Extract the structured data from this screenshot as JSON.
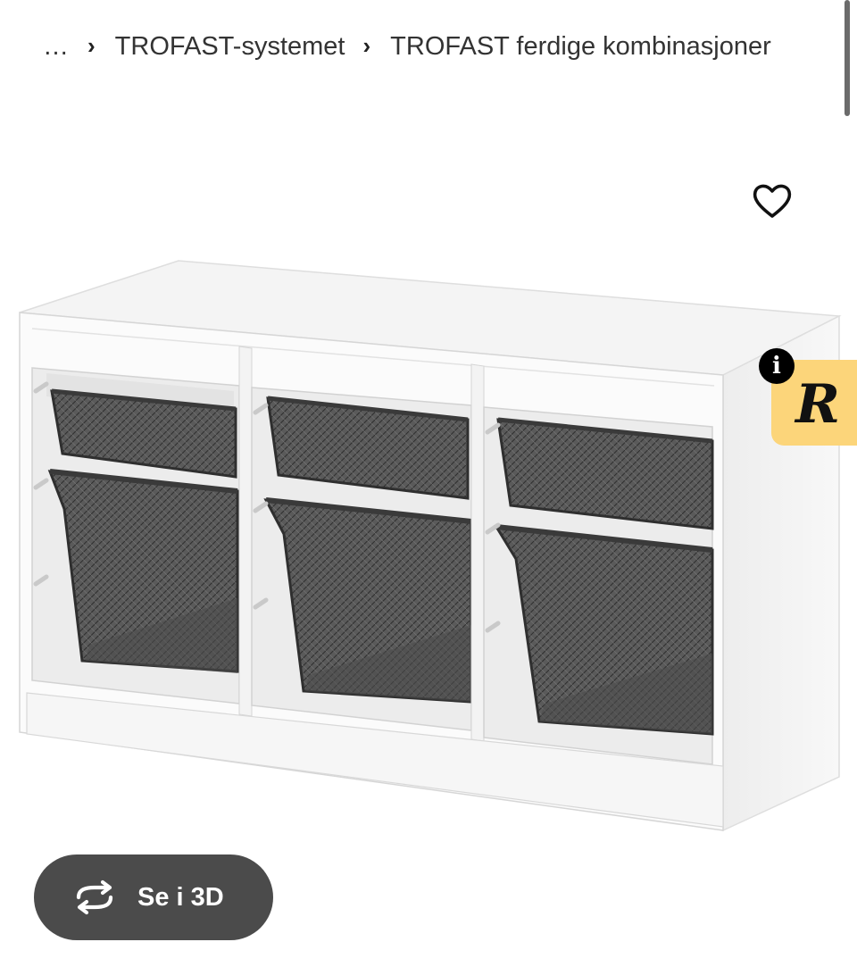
{
  "breadcrumb": {
    "ellipsis": "…",
    "separator": "›",
    "items": [
      {
        "label": "TROFAST-systemet"
      },
      {
        "label": "TROFAST ferdige kombinasjoner"
      }
    ]
  },
  "product": {
    "image_subject": "TROFAST storage combination, white frame with dark grey wire baskets",
    "wishlist_icon": "heart-outline-icon"
  },
  "overlay": {
    "info_icon": "info-icon",
    "info_glyph": "i",
    "extension_letter": "R",
    "extension_color": "#fcd57a"
  },
  "view3d": {
    "label": "Se i 3D",
    "icon": "rotate-3d-icon"
  },
  "colors": {
    "button_bg": "#4b4b4b",
    "basket": "#4a4a4a",
    "frame": "#f7f7f7"
  }
}
